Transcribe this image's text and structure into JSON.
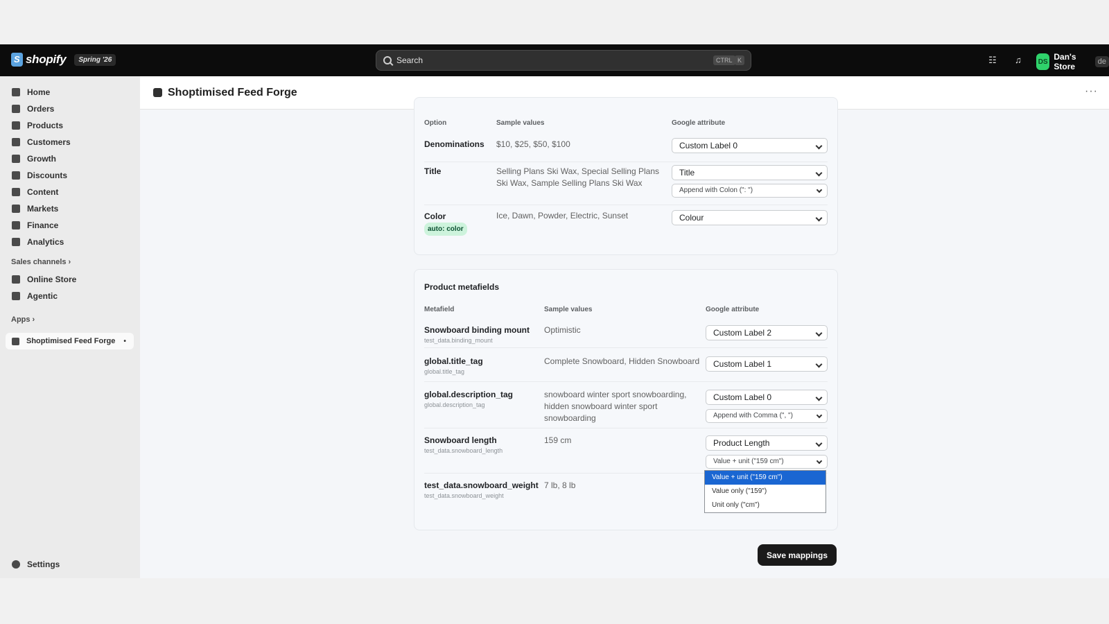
{
  "topbar": {
    "logo_text": "shopify",
    "version_badge": "Spring '26",
    "search_placeholder": "Search",
    "kbd_ctrl": "CTRL",
    "kbd_k": "K",
    "store_initials": "DS",
    "store_name": "Dan's Store",
    "store_tag": "de"
  },
  "sidebar": {
    "items": [
      {
        "label": "Home",
        "icon": "home-icon"
      },
      {
        "label": "Orders",
        "icon": "orders-icon"
      },
      {
        "label": "Products",
        "icon": "products-icon"
      },
      {
        "label": "Customers",
        "icon": "customers-icon"
      },
      {
        "label": "Growth",
        "icon": "growth-icon"
      },
      {
        "label": "Discounts",
        "icon": "discounts-icon"
      },
      {
        "label": "Content",
        "icon": "content-icon"
      },
      {
        "label": "Markets",
        "icon": "markets-icon"
      },
      {
        "label": "Finance",
        "icon": "finance-icon"
      },
      {
        "label": "Analytics",
        "icon": "analytics-icon"
      }
    ],
    "sales_channels_label": "Sales channels",
    "channels": [
      {
        "label": "Online Store",
        "icon": "online-store-icon"
      },
      {
        "label": "Agentic",
        "icon": "agentic-icon"
      }
    ],
    "apps_label": "Apps",
    "active_app": "Shoptimised Feed Forge",
    "settings_label": "Settings"
  },
  "page": {
    "title": "Shoptimised Feed Forge"
  },
  "options_table": {
    "headers": {
      "col1": "Option",
      "col2": "Sample values",
      "col3": "Google attribute"
    },
    "rows": [
      {
        "name": "Denominations",
        "samples": "$10, $25, $50, $100",
        "attribute": "Custom Label 0"
      },
      {
        "name": "Title",
        "samples": "Selling Plans Ski Wax, Special Selling Plans Ski Wax, Sample Selling Plans Ski Wax",
        "attribute": "Title",
        "modifier": "Append with Colon (\": \")"
      },
      {
        "name": "Color",
        "badge": "auto: color",
        "samples": "Ice, Dawn, Powder, Electric, Sunset",
        "attribute": "Colour"
      }
    ]
  },
  "metafields": {
    "section_title": "Product metafields",
    "headers": {
      "col1": "Metafield",
      "col2": "Sample values",
      "col3": "Google attribute"
    },
    "rows": [
      {
        "name": "Snowboard binding mount",
        "key": "test_data.binding_mount",
        "samples": "Optimistic",
        "attribute": "Custom Label 2"
      },
      {
        "name": "global.title_tag",
        "key": "global.title_tag",
        "samples": "Complete Snowboard, Hidden Snowboard",
        "attribute": "Custom Label 1"
      },
      {
        "name": "global.description_tag",
        "key": "global.description_tag",
        "samples": "snowboard winter sport snowboarding, hidden snowboard winter sport snowboarding",
        "attribute": "Custom Label 0",
        "modifier": "Append with Comma (\", \")"
      },
      {
        "name": "Snowboard length",
        "key": "test_data.snowboard_length",
        "samples": "159 cm",
        "attribute": "Product Length",
        "modifier": "Value + unit (\"159 cm\")"
      },
      {
        "name": "test_data.snowboard_weight",
        "key": "test_data.snowboard_weight",
        "samples": "7 lb, 8 lb"
      }
    ],
    "dropdown_options": [
      "Value + unit (\"159 cm\")",
      "Value only (\"159\")",
      "Unit only (\"cm\")"
    ]
  },
  "actions": {
    "save_label": "Save mappings"
  }
}
